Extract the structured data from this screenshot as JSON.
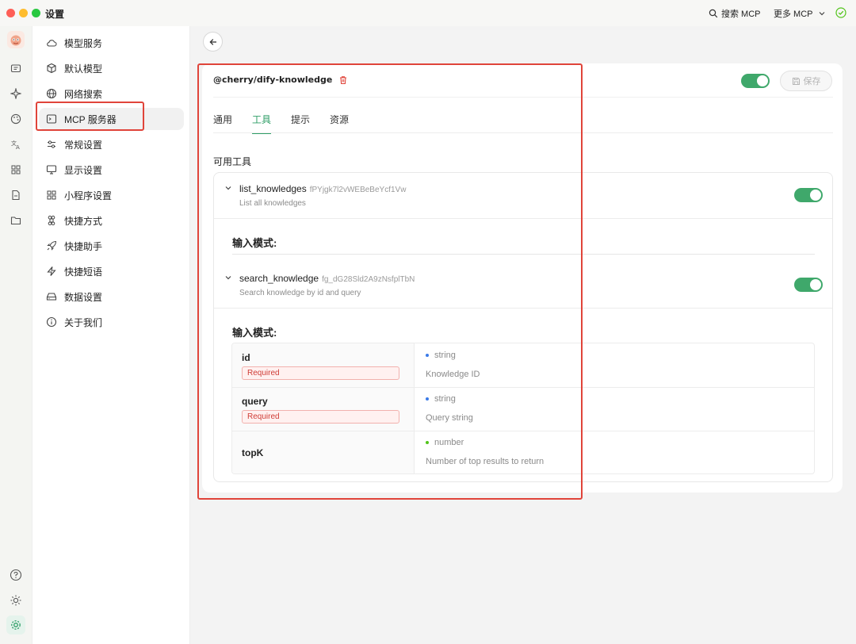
{
  "window": {
    "title": "设置",
    "search_label": "搜索 MCP",
    "more_label": "更多 MCP"
  },
  "sidebar": {
    "items": [
      {
        "label": "模型服务",
        "icon": "cloud-icon"
      },
      {
        "label": "默认模型",
        "icon": "cube-icon"
      },
      {
        "label": "网络搜索",
        "icon": "globe-icon"
      },
      {
        "label": "MCP 服务器",
        "icon": "terminal-icon",
        "active": true
      },
      {
        "label": "常规设置",
        "icon": "sliders-icon"
      },
      {
        "label": "显示设置",
        "icon": "monitor-icon"
      },
      {
        "label": "小程序设置",
        "icon": "grid-icon"
      },
      {
        "label": "快捷方式",
        "icon": "command-icon"
      },
      {
        "label": "快捷助手",
        "icon": "rocket-icon"
      },
      {
        "label": "快捷短语",
        "icon": "zap-icon"
      },
      {
        "label": "数据设置",
        "icon": "drive-icon"
      },
      {
        "label": "关于我们",
        "icon": "info-icon"
      }
    ]
  },
  "server": {
    "name": "@cherry/dify-knowledge",
    "enabled": true,
    "save_label": "保存"
  },
  "tabs": [
    {
      "label": "通用",
      "active": false
    },
    {
      "label": "工具",
      "active": true
    },
    {
      "label": "提示",
      "active": false
    },
    {
      "label": "资源",
      "active": false
    }
  ],
  "tools_section_title": "可用工具",
  "tools": [
    {
      "name": "list_knowledges",
      "id": "fPYjgk7l2vWEBeBeYcf1Vw",
      "description": "List all knowledges",
      "enabled": true,
      "schema_title": "输入模式:"
    },
    {
      "name": "search_knowledge",
      "id": "fg_dG28Sld2A9zNsfplTbN",
      "description": "Search knowledge by id and query",
      "enabled": true,
      "schema_title": "输入模式:",
      "params": [
        {
          "name": "id",
          "required": "Required",
          "type": "string",
          "description": "Knowledge ID"
        },
        {
          "name": "query",
          "required": "Required",
          "type": "string",
          "description": "Query string"
        },
        {
          "name": "topK",
          "required": "",
          "type": "number",
          "description": "Number of top results to return"
        }
      ]
    }
  ],
  "colors": {
    "accent": "#3fa86b",
    "string_dot": "#3b7be8",
    "number_dot": "#52c41a",
    "required_text": "#cf3b35",
    "annotation": "#e0443a"
  }
}
